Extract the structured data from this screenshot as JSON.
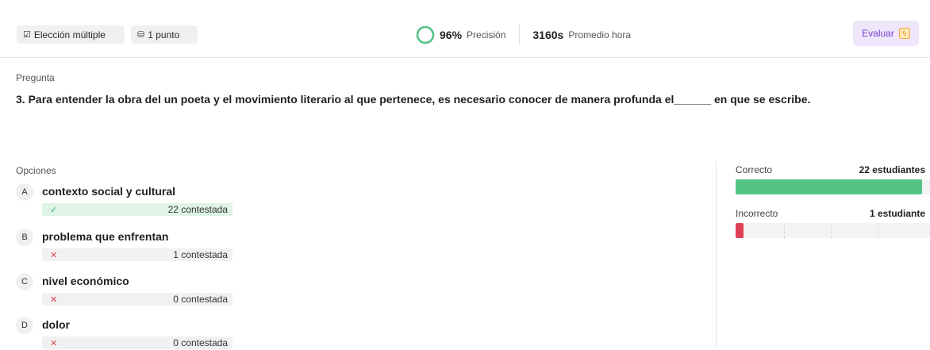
{
  "header": {
    "type_chip": {
      "icon": "checkbox-icon",
      "label": "Elección múltiple"
    },
    "points_chip": {
      "icon": "coins-icon",
      "label": "1 punto"
    },
    "accuracy": {
      "value": "96%",
      "label": "Precisión",
      "fraction": 0.96
    },
    "avg_time": {
      "value": "3160s",
      "label": "Promedio hora"
    },
    "evaluate_button": {
      "label": "Evaluar",
      "icon": "bolt-icon"
    }
  },
  "question": {
    "label": "Pregunta",
    "text": "3. Para entender la obra del un poeta y el movimiento literario al que pertenece, es necesario conocer de manera profunda el______ en que se escribe."
  },
  "options": {
    "label": "Opciones",
    "items": [
      {
        "letter": "A",
        "text": "contexto social y cultural",
        "status": "correct",
        "mark": "✓",
        "count_label": "22 contestada"
      },
      {
        "letter": "B",
        "text": "problema que enfrentan",
        "status": "incorrect",
        "mark": "✕",
        "count_label": "1 contestada"
      },
      {
        "letter": "C",
        "text": "nivel económico",
        "status": "incorrect",
        "mark": "✕",
        "count_label": "0 contestada"
      },
      {
        "letter": "D",
        "text": "dolor",
        "status": "incorrect",
        "mark": "✕",
        "count_label": "0 contestada"
      }
    ]
  },
  "results": {
    "correct": {
      "label": "Correcto",
      "count_label": "22 estudiantes",
      "fraction": 0.96
    },
    "incorrect": {
      "label": "Incorrecto",
      "count_label": "1 estudiante",
      "fraction": 0.04
    }
  },
  "colors": {
    "correct": "#53c486",
    "incorrect": "#e04157",
    "accent": "#7a3fd1"
  }
}
